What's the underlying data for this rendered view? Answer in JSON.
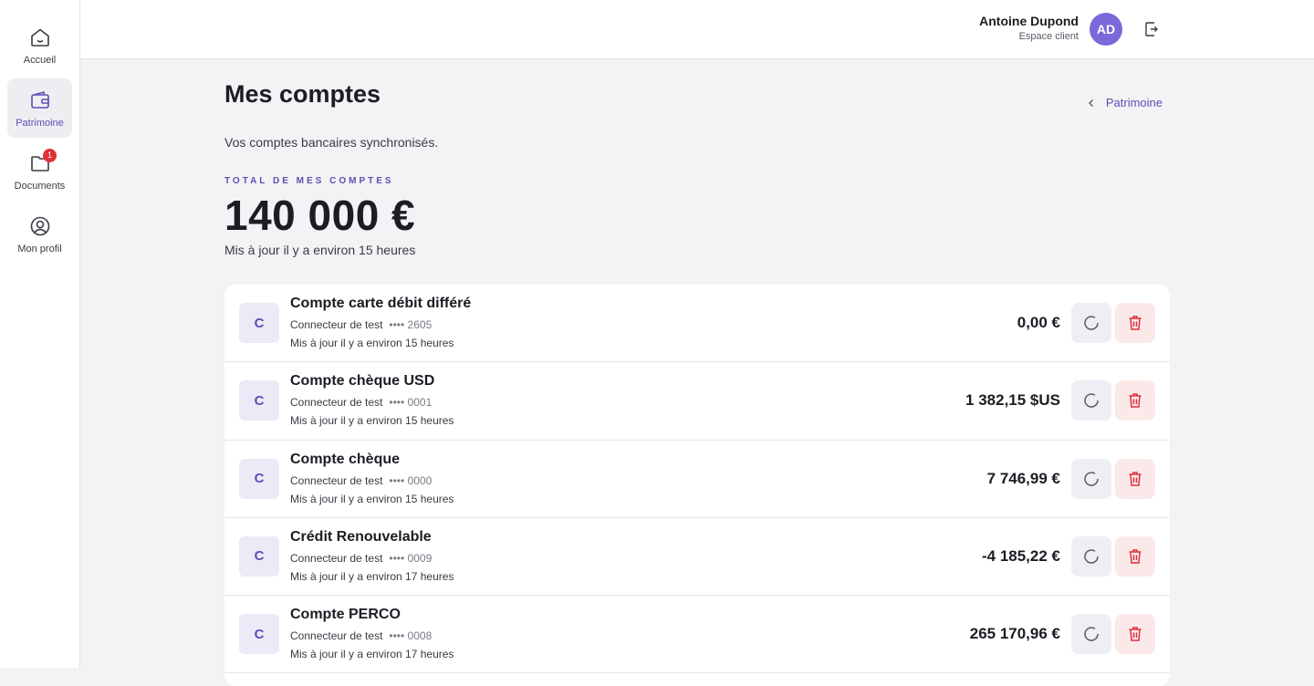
{
  "nav": {
    "items": [
      {
        "label": "Accueil",
        "icon": "home-icon"
      },
      {
        "label": "Patrimoine",
        "icon": "wallet-icon",
        "active": true
      },
      {
        "label": "Documents",
        "icon": "folder-icon",
        "badge": "1"
      },
      {
        "label": "Mon profil",
        "icon": "user-circle-icon"
      }
    ]
  },
  "header": {
    "user_name": "Antoine Dupond",
    "user_role": "Espace client",
    "avatar_initials": "AD",
    "logout_icon": "logout-icon"
  },
  "page": {
    "title": "Mes comptes",
    "back_link": "Patrimoine",
    "subtitle": "Vos comptes bancaires synchronisés.",
    "total_label": "TOTAL DE MES COMPTES",
    "total_amount": "140 000 €",
    "total_updated": "Mis à jour il y a environ 15 heures"
  },
  "accounts": [
    {
      "initial": "C",
      "name": "Compte carte débit différé",
      "connector": "Connecteur de test",
      "mask": "•••• 2605",
      "updated": "Mis à jour il y a environ 15 heures",
      "balance": "0,00 €"
    },
    {
      "initial": "C",
      "name": "Compte chèque USD",
      "connector": "Connecteur de test",
      "mask": "•••• 0001",
      "updated": "Mis à jour il y a environ 15 heures",
      "balance": "1 382,15 $US"
    },
    {
      "initial": "C",
      "name": "Compte chèque",
      "connector": "Connecteur de test",
      "mask": "•••• 0000",
      "updated": "Mis à jour il y a environ 15 heures",
      "balance": "7 746,99 €"
    },
    {
      "initial": "C",
      "name": "Crédit Renouvelable",
      "connector": "Connecteur de test",
      "mask": "•••• 0009",
      "updated": "Mis à jour il y a environ 17 heures",
      "balance": "-4 185,22 €"
    },
    {
      "initial": "C",
      "name": "Compte PERCO",
      "connector": "Connecteur de test",
      "mask": "•••• 0008",
      "updated": "Mis à jour il y a environ 17 heures",
      "balance": "265 170,96 €"
    }
  ],
  "colors": {
    "accent": "#5b4fb5",
    "avatar": "#7b68d9",
    "danger": "#e0303a"
  }
}
